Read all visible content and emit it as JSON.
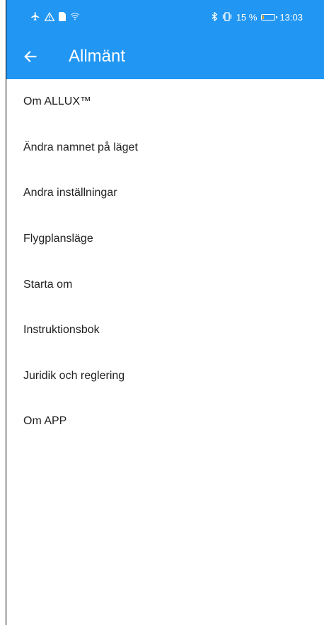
{
  "status_bar": {
    "left_icons": [
      "airplane-icon",
      "warning-icon",
      "sim-icon",
      "wifi-icon"
    ],
    "right_icons": [
      "bluetooth-icon",
      "vibrate-icon"
    ],
    "battery_text": "15 %",
    "battery_level": 0.15,
    "time": "13:03",
    "background_color": "#2196f3"
  },
  "app_bar": {
    "title": "Allmänt",
    "back_icon": "arrow-left-icon",
    "color": "#2196f3"
  },
  "menu": {
    "items": [
      {
        "label": "Om ALLUX™"
      },
      {
        "label": "Ändra namnet på läget"
      },
      {
        "label": "Andra inställningar"
      },
      {
        "label": "Flygplansläge"
      },
      {
        "label": "Starta om"
      },
      {
        "label": "Instruktionsbok"
      },
      {
        "label": "Juridik och reglering"
      },
      {
        "label": "Om APP"
      }
    ]
  }
}
